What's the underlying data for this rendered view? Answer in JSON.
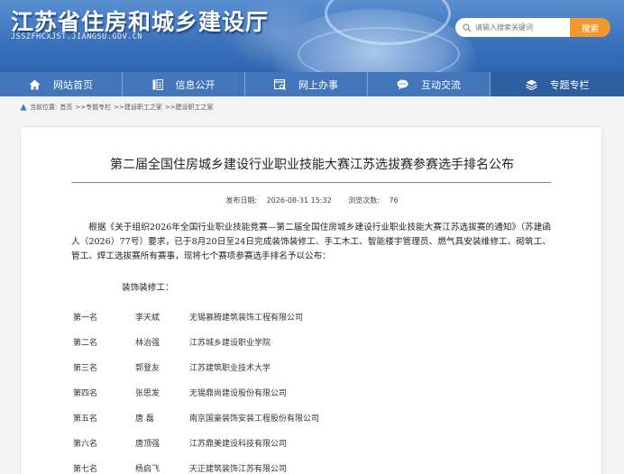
{
  "header": {
    "site_title": "江苏省住房和城乡建设厅",
    "site_domain": "JSSZFHCXJST.JIANGSU.GOV.CN",
    "search_placeholder": "请输入搜索关键词",
    "search_button": "搜索"
  },
  "nav": {
    "items": [
      {
        "label": "网站首页",
        "icon": "home-icon"
      },
      {
        "label": "信息公开",
        "icon": "document-list-icon"
      },
      {
        "label": "网上办事",
        "icon": "browser-window-icon"
      },
      {
        "label": "互动交流",
        "icon": "chat-bubble-icon"
      },
      {
        "label": "专题专栏",
        "icon": "layers-icon"
      }
    ],
    "active_index": 4
  },
  "breadcrumb": {
    "prefix": "当前位置:",
    "items": [
      "首页",
      ">>专题专栏",
      ">>建设职工之家",
      ">>建设职工之家"
    ]
  },
  "article": {
    "title": "第二届全国住房城乡建设行业职业技能大赛江苏选拔赛参赛选手排名公布",
    "publish_label": "发布日期:",
    "publish_date": "2026-08-31 15:32",
    "views_label": "浏览次数:",
    "views": "76",
    "paragraph": "根据《关于组织2026年全国行业职业技能竞赛—第二届全国住房城乡建设行业职业技能大赛江苏选拔赛的通知》（苏建函人（2026）77号）要求，已于8月20日至24日完成装饰装修工、手工木工、智能楼宇管理员、燃气具安装维修工、砌筑工、管工、焊工选拔赛所有赛事，现将七个赛项参赛选手排名予以公布：",
    "section_label": "装饰装修工：",
    "rankings": [
      {
        "rank": "第一名",
        "name": "李天斌",
        "company": "无锡慕腾建筑装饰工程有限公司"
      },
      {
        "rank": "第二名",
        "name": "林治强",
        "company": "江苏城乡建设职业学院"
      },
      {
        "rank": "第三名",
        "name": "郭登友",
        "company": "江苏建筑职业技术大学"
      },
      {
        "rank": "第四名",
        "name": "张思发",
        "company": "无锡鼎尚建设股份有限公司"
      },
      {
        "rank": "第五名",
        "name": "唐 磊",
        "company": "南京国豪装饰安装工程股份有限公司"
      },
      {
        "rank": "第六名",
        "name": "唐顶强",
        "company": "江苏鼎美建设科技有限公司"
      },
      {
        "rank": "第七名",
        "name": "杨启飞",
        "company": "天正建筑装饰江苏有限公司"
      }
    ]
  },
  "colors": {
    "header_blue": "#3d73bd",
    "nav_blue": "#4275b9",
    "nav_active": "#2d5e9f",
    "search_button": "#f09a2e"
  }
}
